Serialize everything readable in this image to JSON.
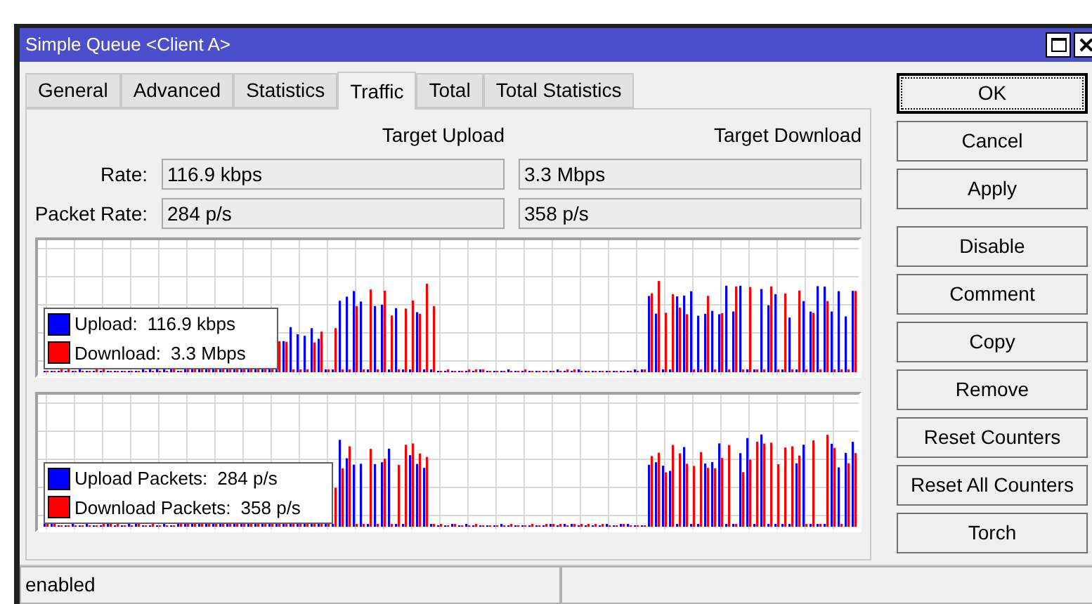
{
  "window": {
    "title": "Simple Queue <Client A>"
  },
  "tabs": [
    {
      "label": "General",
      "selected": false
    },
    {
      "label": "Advanced",
      "selected": false
    },
    {
      "label": "Statistics",
      "selected": false
    },
    {
      "label": "Traffic",
      "selected": true
    },
    {
      "label": "Total",
      "selected": false
    },
    {
      "label": "Total Statistics",
      "selected": false
    }
  ],
  "columns": [
    "Target Upload",
    "Target Download"
  ],
  "fields": [
    {
      "label": "Rate:",
      "upload": "116.9 kbps",
      "download": "3.3 Mbps"
    },
    {
      "label": "Packet Rate:",
      "upload": "284 p/s",
      "download": "358 p/s"
    }
  ],
  "graphs": [
    {
      "legend": [
        {
          "label": "Upload:",
          "value": "116.9 kbps",
          "color": "#0000ff"
        },
        {
          "label": "Download:",
          "value": "3.3 Mbps",
          "color": "#ff0000"
        }
      ]
    },
    {
      "legend": [
        {
          "label": "Upload Packets:",
          "value": "284 p/s",
          "color": "#0000ff"
        },
        {
          "label": "Download Packets:",
          "value": "358 p/s",
          "color": "#ff0000"
        }
      ]
    }
  ],
  "buttons": [
    {
      "label": "OK",
      "focused": true
    },
    {
      "label": "Cancel",
      "focused": false
    },
    {
      "label": "Apply",
      "focused": false
    },
    {
      "label": "Disable",
      "focused": false
    },
    {
      "label": "Comment",
      "focused": false
    },
    {
      "label": "Copy",
      "focused": false
    },
    {
      "label": "Remove",
      "focused": false
    },
    {
      "label": "Reset Counters",
      "focused": false
    },
    {
      "label": "Reset All Counters",
      "focused": false
    },
    {
      "label": "Torch",
      "focused": false
    }
  ],
  "status_bar": {
    "text": "enabled"
  }
}
